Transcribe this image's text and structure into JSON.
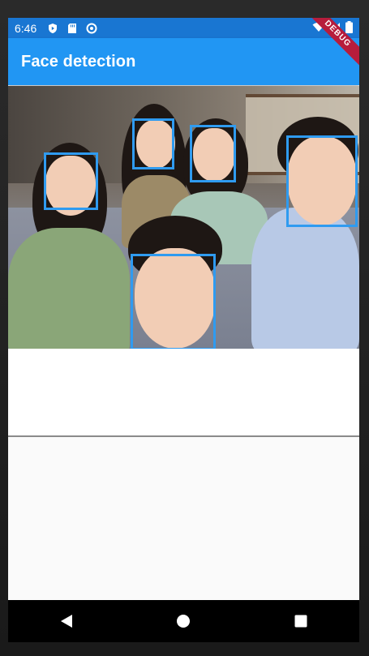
{
  "status_bar": {
    "time": "6:46",
    "icons_left": [
      "shield-play-icon",
      "sd-card-icon",
      "sync-circle-icon"
    ],
    "icons_right": [
      "wifi-icon",
      "signal-icon",
      "battery-icon"
    ]
  },
  "app_bar": {
    "title": "Face detection",
    "color": "#2196f3"
  },
  "debug_banner": {
    "label": "DEBUG"
  },
  "photo": {
    "face_count": 5,
    "box_color": "#2f9bf0"
  },
  "nav_bar": {
    "buttons": [
      "back-triangle-icon",
      "home-circle-icon",
      "recents-square-icon"
    ]
  }
}
